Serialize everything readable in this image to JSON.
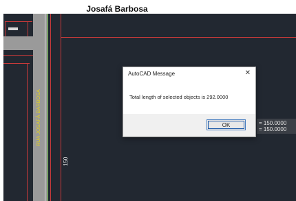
{
  "page": {
    "title": "Josafá Barbosa"
  },
  "drawing": {
    "street_label": "RUA JOSAFÁ BARBOSA",
    "dimension_label": "150",
    "coordinate_readout": [
      "= 150.0000",
      "= 150.0000"
    ],
    "colors": {
      "background": "#222831",
      "road": "#9a9a9a",
      "red_line": "#c93a3a",
      "green_line": "#55aa33",
      "street_label": "#e3d21d"
    }
  },
  "dialog": {
    "title": "AutoCAD Message",
    "close_glyph": "✕",
    "message": "Total length of selected objects is 292.0000",
    "ok_label": "OK"
  }
}
